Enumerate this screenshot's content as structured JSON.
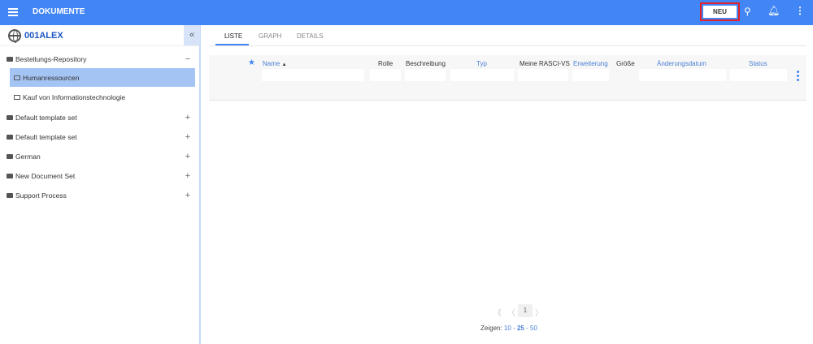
{
  "header": {
    "title": "DOKUMENTE",
    "new_label": "NEU",
    "icons": [
      "menu-icon",
      "search-icon",
      "bell-icon",
      "more-vert-icon"
    ]
  },
  "sidebar": {
    "workspace": "001ALEX",
    "items": [
      {
        "label": "Bestellungs-Repository",
        "toggle": "−",
        "type": "repository"
      },
      {
        "label": "Humanressourcen",
        "type": "folder",
        "selected": true
      },
      {
        "label": "Kauf von Informationstechnologie",
        "type": "folder"
      },
      {
        "label": "Default template set",
        "toggle": "+",
        "type": "repository"
      },
      {
        "label": "Default template set",
        "toggle": "+",
        "type": "repository"
      },
      {
        "label": "German",
        "toggle": "+",
        "type": "repository"
      },
      {
        "label": "New Document Set",
        "toggle": "+",
        "type": "repository"
      },
      {
        "label": "Support Process",
        "toggle": "+",
        "type": "repository"
      }
    ]
  },
  "tabs": [
    {
      "label": "LISTE",
      "active": true
    },
    {
      "label": "GRAPH"
    },
    {
      "label": "DETAILS"
    }
  ],
  "table": {
    "columns": [
      {
        "label": "Name",
        "sort": "▲",
        "sortable": true
      },
      {
        "label": "Rolle"
      },
      {
        "label": "Beschreibung"
      },
      {
        "label": "Typ",
        "sortable": true
      },
      {
        "label": "Meine RASCI-VS"
      },
      {
        "label": "Erweiterung",
        "sortable": true
      },
      {
        "label": "Größe"
      },
      {
        "label": "Änderungsdatum",
        "sortable": true
      },
      {
        "label": "Status",
        "sortable": true
      }
    ]
  },
  "pagination": {
    "first": "《",
    "prev": "〈",
    "page": "1",
    "next": "〉",
    "show_label": "Zeigen:",
    "sizes": [
      "10",
      "25",
      "50"
    ],
    "active_size": "25",
    "sep": "-"
  },
  "colors": {
    "header": "#4285f4",
    "selected": "#a4c4f4",
    "link": "#4a7fd6",
    "highlight_border": "#e0202a"
  }
}
